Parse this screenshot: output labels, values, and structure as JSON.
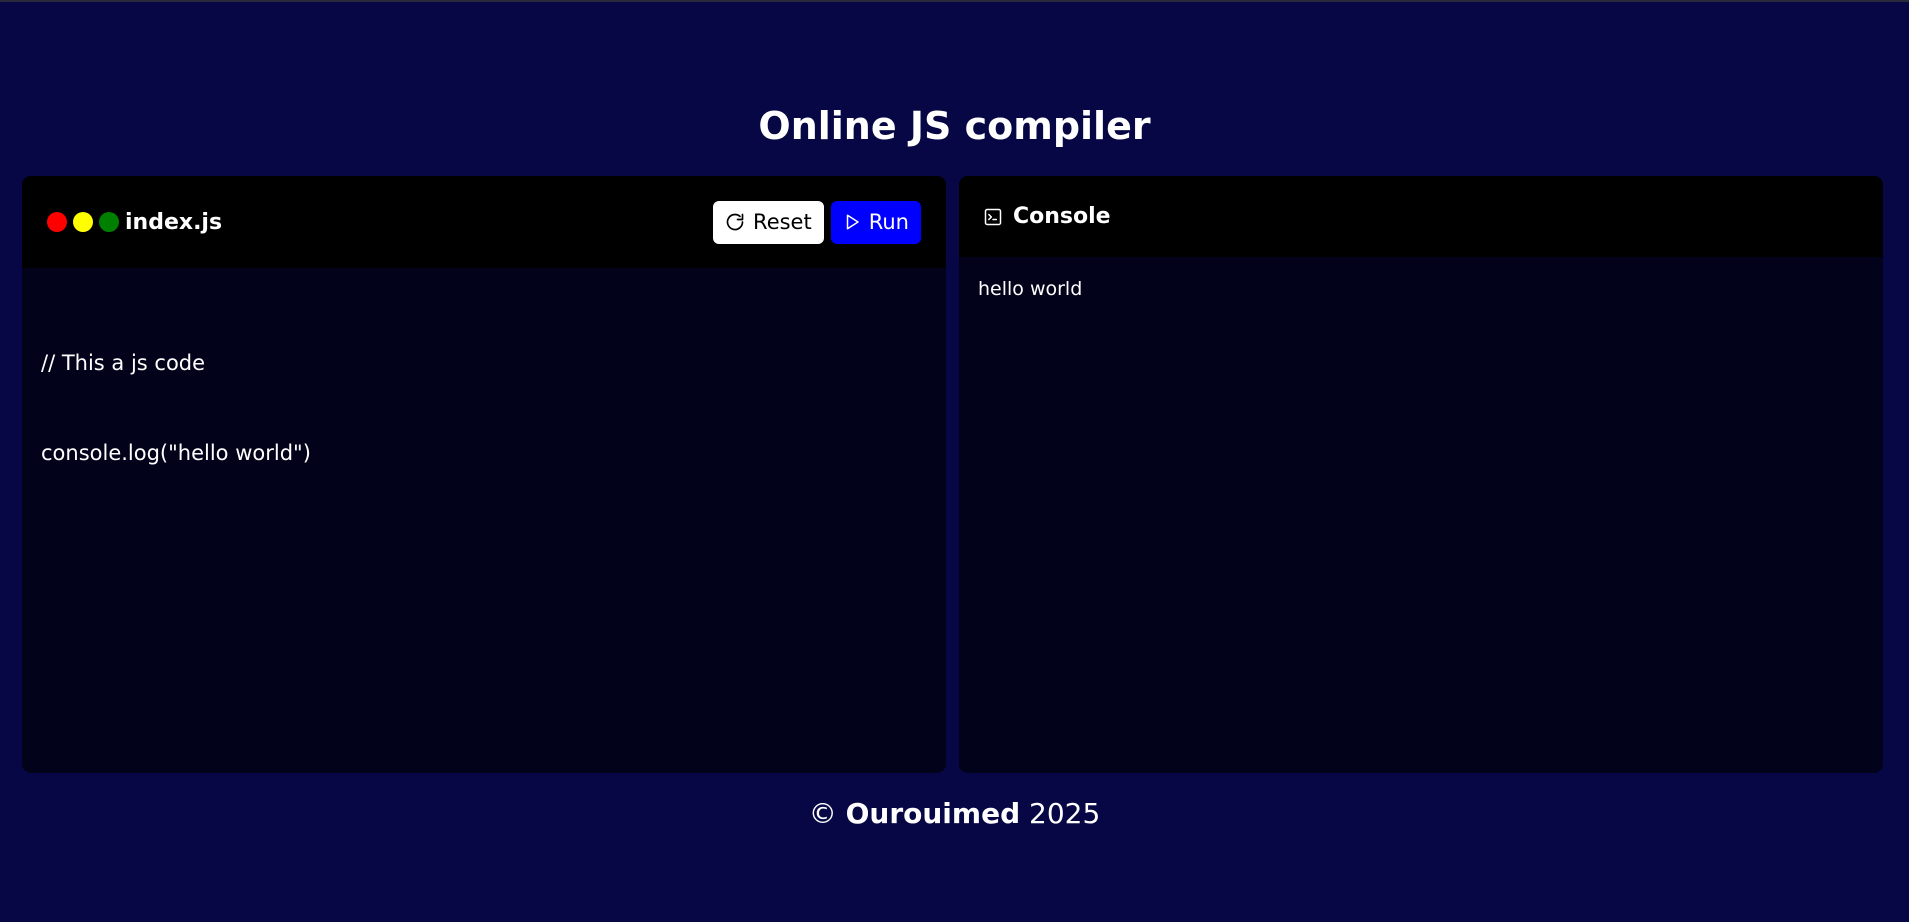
{
  "page": {
    "title": "Online JS compiler"
  },
  "editor": {
    "filename": "index.js",
    "window_dots": [
      "#ff0000",
      "#ffff00",
      "#008000"
    ],
    "reset_label": "Reset",
    "run_label": "Run",
    "code_lines": [
      "// This a js code",
      "console.log(\"hello world\")"
    ]
  },
  "console": {
    "title": "Console",
    "output_lines": [
      "hello world"
    ]
  },
  "footer": {
    "copyright_symbol": "©",
    "author": "Ourouimed",
    "year": "2025"
  },
  "colors": {
    "background": "#070745",
    "panel": "#02031a",
    "header": "#000000",
    "run_button": "#0000ff",
    "reset_button": "#ffffff"
  }
}
